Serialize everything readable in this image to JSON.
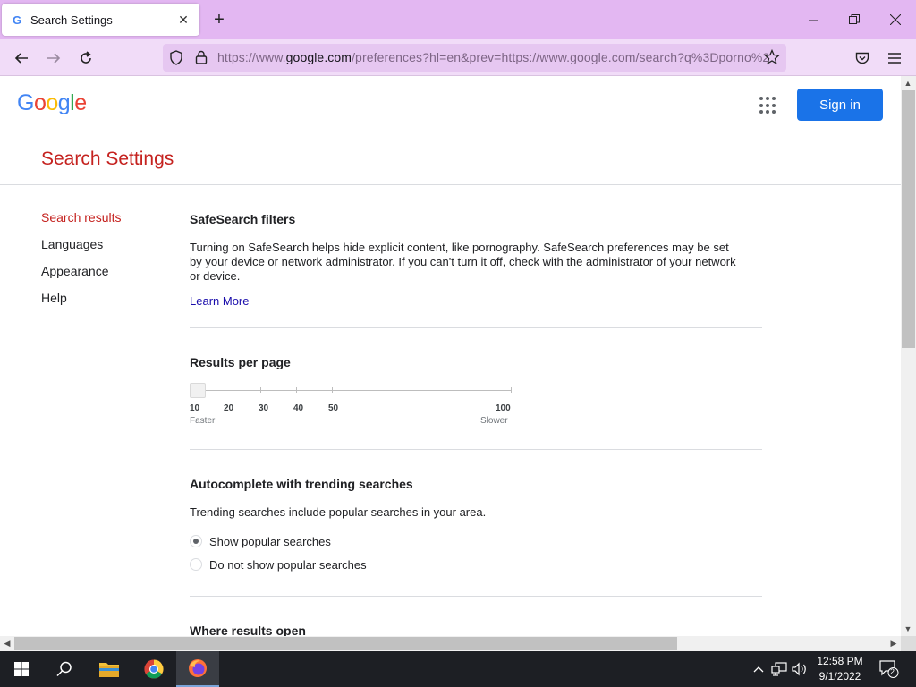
{
  "browser": {
    "tab_title": "Search Settings",
    "url_prefix": "https://www.",
    "url_domain": "google.com",
    "url_path": "/preferences?hl=en&prev=https://www.google.com/search?q%3Dporno%2",
    "theme_color": "#e3b7f2"
  },
  "header": {
    "logo_letters": [
      "G",
      "o",
      "o",
      "g",
      "l",
      "e"
    ],
    "logo_colors": [
      "#4285f4",
      "#ea4335",
      "#fbbc05",
      "#4285f4",
      "#34a853",
      "#ea4335"
    ],
    "signin_label": "Sign in"
  },
  "page": {
    "title": "Search Settings"
  },
  "sidenav": {
    "items": [
      "Search results",
      "Languages",
      "Appearance",
      "Help"
    ]
  },
  "safesearch": {
    "heading": "SafeSearch filters",
    "description": "Turning on SafeSearch helps hide explicit content, like pornography. SafeSearch preferences may be set by your device or network administrator. If you can't turn it off, check with the administrator of your network or device.",
    "link": "Learn More"
  },
  "results_per_page": {
    "heading": "Results per page",
    "values": [
      "10",
      "20",
      "30",
      "40",
      "50",
      "100"
    ],
    "selected": "10",
    "low_label": "Faster",
    "high_label": "Slower"
  },
  "autocomplete": {
    "heading": "Autocomplete with trending searches",
    "description": "Trending searches include popular searches in your area.",
    "options": [
      "Show popular searches",
      "Do not show popular searches"
    ],
    "selected_index": 0
  },
  "where_results_open": {
    "heading": "Where results open"
  },
  "taskbar": {
    "time": "12:58 PM",
    "date": "9/1/2022",
    "notification_count": "2"
  }
}
